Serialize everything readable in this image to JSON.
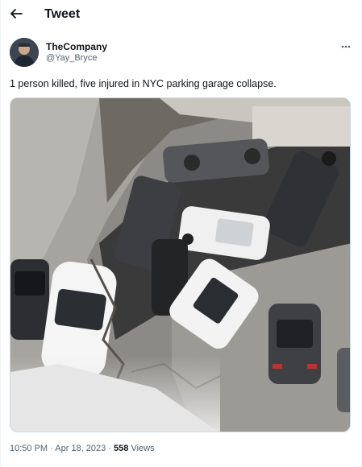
{
  "header": {
    "title": "Tweet"
  },
  "tweet": {
    "author": {
      "name": "TheCompany",
      "handle": "@Yay_Bryce"
    },
    "text": "1 person killed, five injured in NYC parking garage collapse.",
    "meta": {
      "time": "10:50 PM",
      "separator": " · ",
      "date": "Apr 18, 2023",
      "views_count": "558",
      "views_label": " Views"
    }
  },
  "icons": {
    "back": "arrow-left-icon",
    "more": "more-horizontal-icon"
  },
  "colors": {
    "text_primary": "#0f1419",
    "text_secondary": "#536471",
    "border": "#cfd9de"
  }
}
